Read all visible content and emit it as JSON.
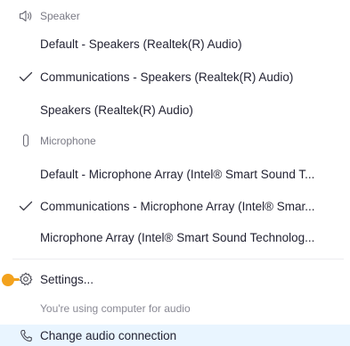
{
  "speaker": {
    "header": "Speaker",
    "icon": "speaker-icon",
    "items": [
      {
        "label": "Default - Speakers (Realtek(R) Audio)",
        "checked": false
      },
      {
        "label": "Communications - Speakers (Realtek(R) Audio)",
        "checked": true
      },
      {
        "label": "Speakers (Realtek(R) Audio)",
        "checked": false
      }
    ]
  },
  "microphone": {
    "header": "Microphone",
    "icon": "microphone-icon",
    "items": [
      {
        "label": "Default - Microphone Array (Intel® Smart Sound T...",
        "checked": false
      },
      {
        "label": "Communications - Microphone Array (Intel® Smar...",
        "checked": true
      },
      {
        "label": "Microphone Array (Intel® Smart Sound Technolog...",
        "checked": false
      }
    ]
  },
  "settings": {
    "label": "Settings...",
    "icon": "gear-icon"
  },
  "status": {
    "text": "You're using computer for audio"
  },
  "change_audio": {
    "label": "Change audio connection",
    "icon": "phone-icon"
  },
  "colors": {
    "highlight_bg": "#e9f5ff",
    "cursor": "#f3a21d",
    "text": "#232333",
    "muted": "#7a7a85"
  }
}
